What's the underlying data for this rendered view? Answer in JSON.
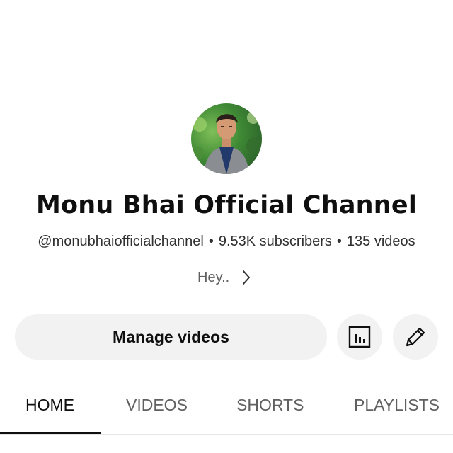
{
  "channel": {
    "title": "Monu Bhai Official Channel",
    "handle": "@monubhaiofficialchannel",
    "subscribers": "9.53K subscribers",
    "videos": "135 videos",
    "separator": "•",
    "description": "Hey.."
  },
  "actions": {
    "manage_label": "Manage videos",
    "analytics_icon": "analytics-icon",
    "edit_icon": "pencil-icon"
  },
  "tabs": [
    {
      "label": "HOME",
      "active": true
    },
    {
      "label": "VIDEOS",
      "active": false
    },
    {
      "label": "SHORTS",
      "active": false
    },
    {
      "label": "PLAYLISTS",
      "active": false
    }
  ],
  "colors": {
    "text_primary": "#0f0f0f",
    "text_secondary": "#606060",
    "button_bg": "#f2f2f2"
  }
}
